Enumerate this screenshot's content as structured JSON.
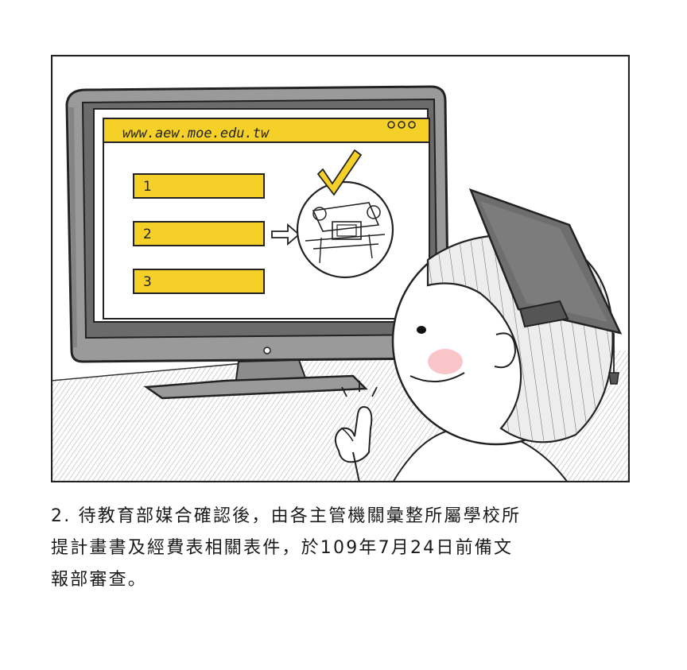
{
  "illustration": {
    "browser_url": "www.aew.moe.edu.tw",
    "list_items": [
      "1",
      "2",
      "3"
    ],
    "accent_color": "#f5d028",
    "icons": [
      "checkmark-icon",
      "arrow-right-icon",
      "thumbs-up-icon",
      "graduation-cap-icon",
      "window-dots-icon"
    ]
  },
  "caption": {
    "line1": "2.  待教育部媒合確認後，由各主管機關彙整所屬學校所",
    "line2": "提計畫書及經費表相關表件，於109年7月24日前備文",
    "line3": "報部審查。"
  }
}
